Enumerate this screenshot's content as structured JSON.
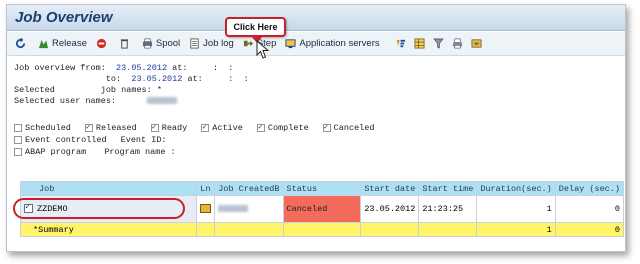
{
  "window": {
    "title": "Job Overview"
  },
  "toolbar": {
    "items": [
      {
        "label": "",
        "icon": "refresh-icon"
      },
      {
        "label": "Release",
        "icon": "release-icon"
      },
      {
        "label": "",
        "icon": "stop-icon"
      },
      {
        "label": "",
        "icon": "delete-icon"
      },
      {
        "label": "Spool",
        "icon": "spool-icon"
      },
      {
        "label": "Job log",
        "icon": "job-log-icon"
      },
      {
        "label": "Step",
        "icon": "step-icon"
      },
      {
        "label": "Application servers",
        "icon": "app-servers-icon"
      }
    ],
    "right_icons": [
      "sort-icon",
      "layout-icon",
      "filter-icon",
      "print-icon",
      "export-icon"
    ]
  },
  "callout": {
    "text": "Click Here"
  },
  "criteria": {
    "from_label": "Job overview from:",
    "from_date": "23.05.2012",
    "from_at": "at:",
    "from_time": ":  :",
    "to_label": "to:",
    "to_date": "23.05.2012",
    "to_at": "at:",
    "to_time": ":  :",
    "selected_label": "Selected",
    "job_names_label": "job names:",
    "job_names_value": "*",
    "user_names_label": "Selected user names:"
  },
  "filters": {
    "row1": [
      {
        "label": "Scheduled",
        "checked": false
      },
      {
        "label": "Released",
        "checked": true
      },
      {
        "label": "Ready",
        "checked": true
      },
      {
        "label": "Active",
        "checked": true
      },
      {
        "label": "Complete",
        "checked": true
      },
      {
        "label": "Canceled",
        "checked": true
      }
    ],
    "row2_label": "Event controlled",
    "row2_event_id": "Event ID:",
    "row3_label": "ABAP program",
    "row3_program": "Program name :"
  },
  "grid": {
    "headers": [
      "Job",
      "Ln",
      "Job CreatedB",
      "Status",
      "Start date",
      "Start time",
      "Duration(sec.)",
      "Delay (sec.)"
    ],
    "rows": [
      {
        "job": "ZZDEMO",
        "status": "Canceled",
        "start_date": "23.05.2012",
        "start_time": "21:23:25",
        "duration": "1",
        "delay": "0"
      }
    ],
    "summary": {
      "label": "*Summary",
      "duration": "1",
      "delay": "0"
    }
  },
  "colors": {
    "status_canceled": "#f26b5b",
    "header_bg": "#aee0f3",
    "summary_bg": "#fff46a",
    "accent_red": "#c8202a"
  }
}
